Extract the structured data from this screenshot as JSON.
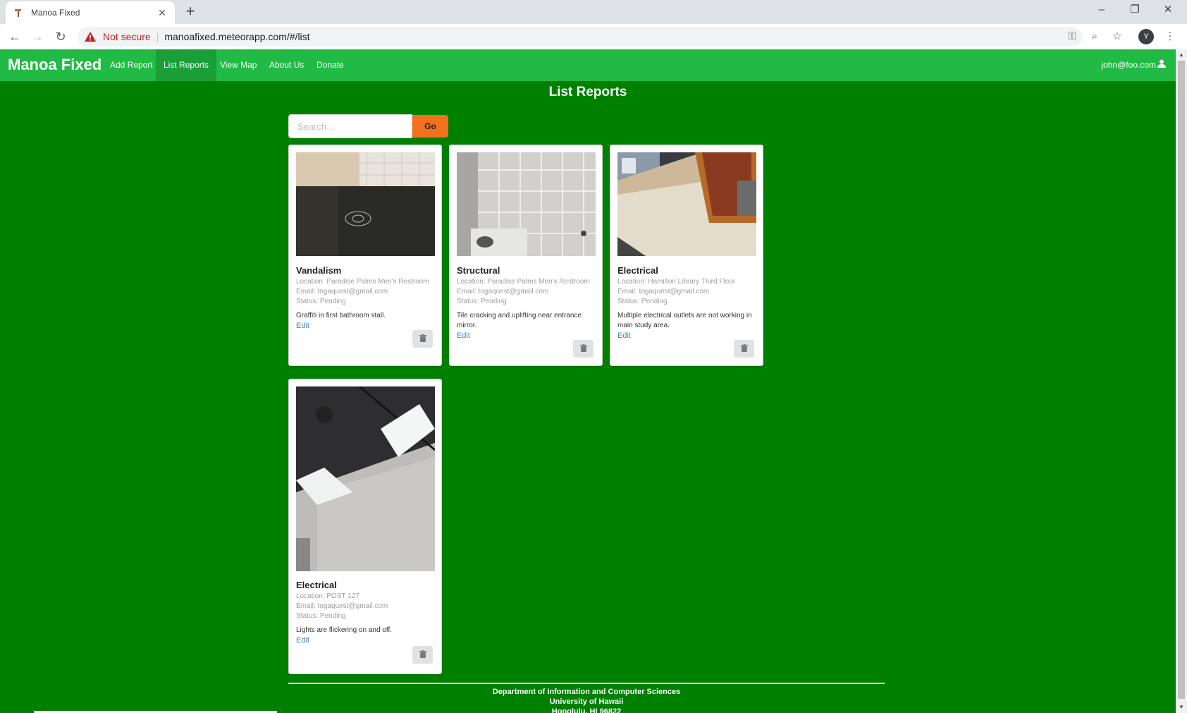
{
  "browser": {
    "tab_title": "Manoa Fixed",
    "new_tab": "+",
    "not_secure": "Not secure",
    "url": "manoafixed.meteorapp.com/#/list",
    "profile_initial": "Y"
  },
  "app": {
    "brand": "Manoa Fixed",
    "nav": [
      {
        "label": "Add Report"
      },
      {
        "label": "List Reports",
        "active": true
      },
      {
        "label": "View Map"
      },
      {
        "label": "About Us"
      },
      {
        "label": "Donate"
      }
    ],
    "user_email": "john@foo.com"
  },
  "page": {
    "title": "List Reports",
    "search_placeholder": "Search...",
    "go_label": "Go"
  },
  "reports": [
    {
      "title": "Vandalism",
      "location": "Location: Paradise Palms Men's Restroom",
      "email": "Email: togaquest@gmail.com",
      "status": "Status: Pending",
      "description": "Graffiti in first bathroom stall.",
      "edit": "Edit"
    },
    {
      "title": "Structural",
      "location": "Location: Paradise Palms Men's Restroom",
      "email": "Email: togaquest@gmail.com",
      "status": "Status: Pending",
      "description": "Tile cracking and uplifting near entrance mirror.",
      "edit": "Edit"
    },
    {
      "title": "Electrical",
      "location": "Location: Hamilton Library Third Floor",
      "email": "Email: togaquest@gmail.com",
      "status": "Status: Pending",
      "description": "Multiple electrical outlets are not working in main study area.",
      "edit": "Edit"
    },
    {
      "title": "Electrical",
      "location": "Location: POST 127",
      "email": "Email: togaquest@gmail.com",
      "status": "Status: Pending",
      "description": "Lights are flickering on and off.",
      "edit": "Edit"
    }
  ],
  "footer": {
    "line1": "Department of Information and Computer Sciences",
    "line2": "University of Hawaii",
    "line3": "Honolulu, HI 96822"
  },
  "colors": {
    "page_bg": "#008000",
    "navbar": "#21ba45",
    "go_button": "#f2711c",
    "link": "#4183c4"
  }
}
